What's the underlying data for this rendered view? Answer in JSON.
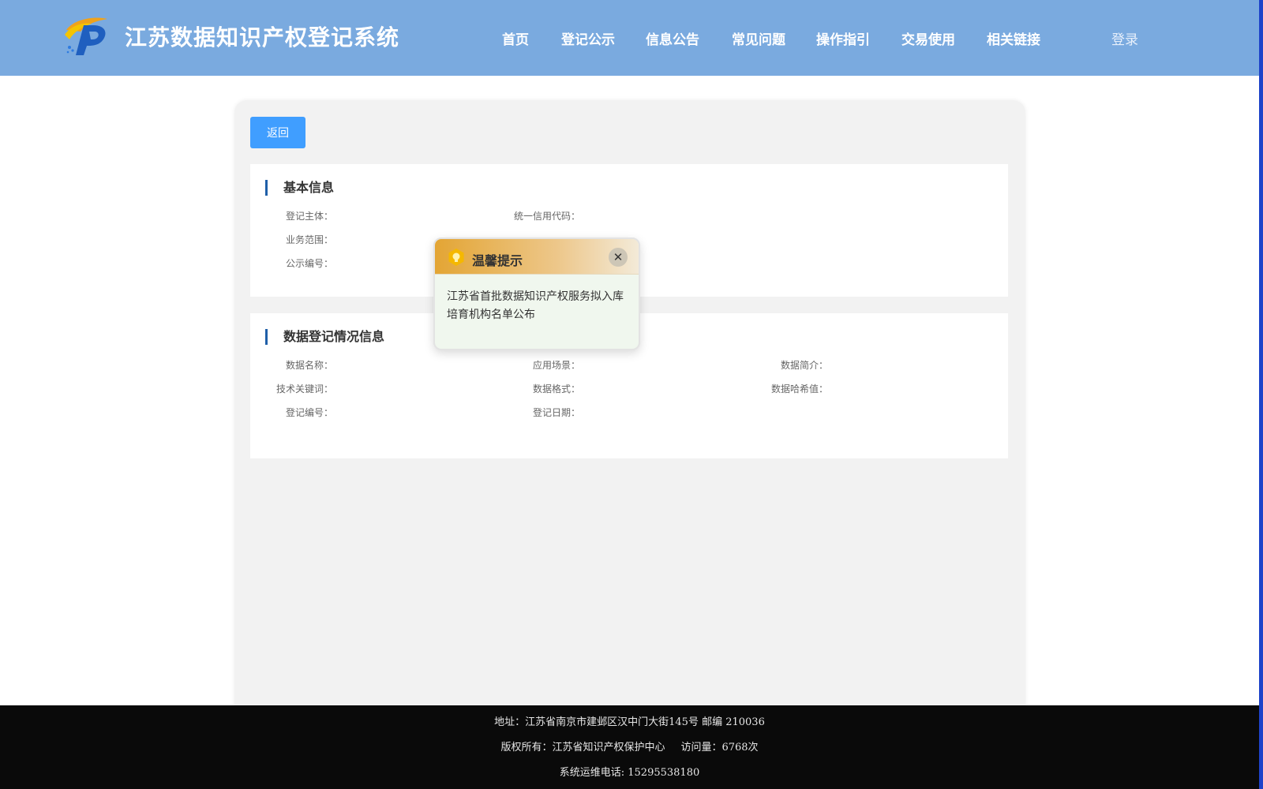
{
  "header": {
    "title": "江苏数据知识产权登记系统",
    "login": "登录",
    "nav": [
      "首页",
      "登记公示",
      "信息公告",
      "常见问题",
      "操作指引",
      "交易使用",
      "相关链接"
    ]
  },
  "card": {
    "back_label": "返回",
    "basic_section": {
      "title": "基本信息",
      "fields": {
        "subject": "登记主体：",
        "credit_code": "统一信用代码：",
        "scope": "业务范围：",
        "publicity_no": "公示编号："
      }
    },
    "data_section": {
      "title": "数据登记情况信息",
      "fields": {
        "data_name": "数据名称：",
        "scenario": "应用场景：",
        "summary": "数据简介：",
        "keywords": "技术关键词：",
        "format": "数据格式：",
        "hash": "数据哈希值：",
        "reg_no": "登记编号：",
        "reg_date": "登记日期："
      }
    }
  },
  "popup": {
    "title": "温馨提示",
    "close_icon": "close-icon",
    "message": "江苏省首批数据知识产权服务拟入库培育机构名单公布"
  },
  "footer": {
    "address": "地址：江苏省南京市建邺区汉中门大街145号 邮编 210036",
    "copyright": "版权所有：江苏省知识产权保护中心",
    "visits": "访问量：6768次",
    "phone": "系统运维电话: 15295538180"
  },
  "colors": {
    "header_bg": "#7aaadf",
    "button_blue": "#409eff",
    "footer_bg": "#0a0a0a",
    "section_accent": "#1f5fa8"
  }
}
